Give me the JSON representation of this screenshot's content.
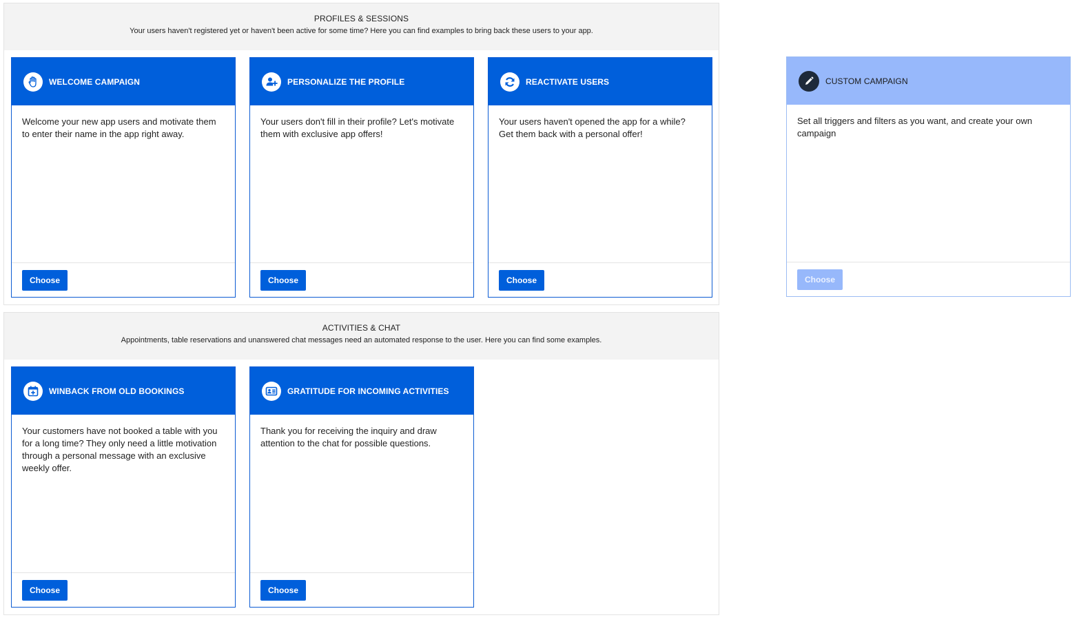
{
  "sections": [
    {
      "title": "PROFILES & SESSIONS",
      "subtitle": "Your users haven't registered yet or haven't been active for some time? Here you can find examples to bring back these users to your app.",
      "cards": [
        {
          "title": "WELCOME CAMPAIGN",
          "icon": "hand-wave-icon",
          "description": "Welcome your new app users and motivate them to enter their name in the app right away.",
          "button": "Choose"
        },
        {
          "title": "PERSONALIZE THE PROFILE",
          "icon": "add-user-icon",
          "description": "Your users don't fill in their profile? Let's motivate them with exclusive app offers!",
          "button": "Choose"
        },
        {
          "title": "REACTIVATE USERS",
          "icon": "refresh-icon",
          "description": "Your users haven't opened the app for a while? Get them back with a personal offer!",
          "button": "Choose"
        }
      ]
    },
    {
      "title": "ACTIVITIES & CHAT",
      "subtitle": "Appointments, table reservations and unanswered chat messages need an automated response to the user. Here you can find some examples.",
      "cards": [
        {
          "title": "WINBACK FROM OLD BOOKINGS",
          "icon": "calendar-icon",
          "description": "Your customers have not booked a table with you for a long time? They only need a little motivation through a personal message with an exclusive weekly offer.",
          "button": "Choose"
        },
        {
          "title": "GRATITUDE FOR INCOMING ACTIVITIES",
          "icon": "contact-card-icon",
          "description": "Thank you for receiving the inquiry and draw attention to the chat for possible questions.",
          "button": "Choose"
        }
      ]
    }
  ],
  "custom": {
    "title": "CUSTOM CAMPAIGN",
    "icon": "pencil-icon",
    "description": "Set all triggers and filters as you want, and create your own campaign",
    "button": "Choose"
  },
  "colors": {
    "primary": "#005fdb",
    "custom_header": "#97b8fb",
    "section_header_bg": "#f3f3f3"
  }
}
